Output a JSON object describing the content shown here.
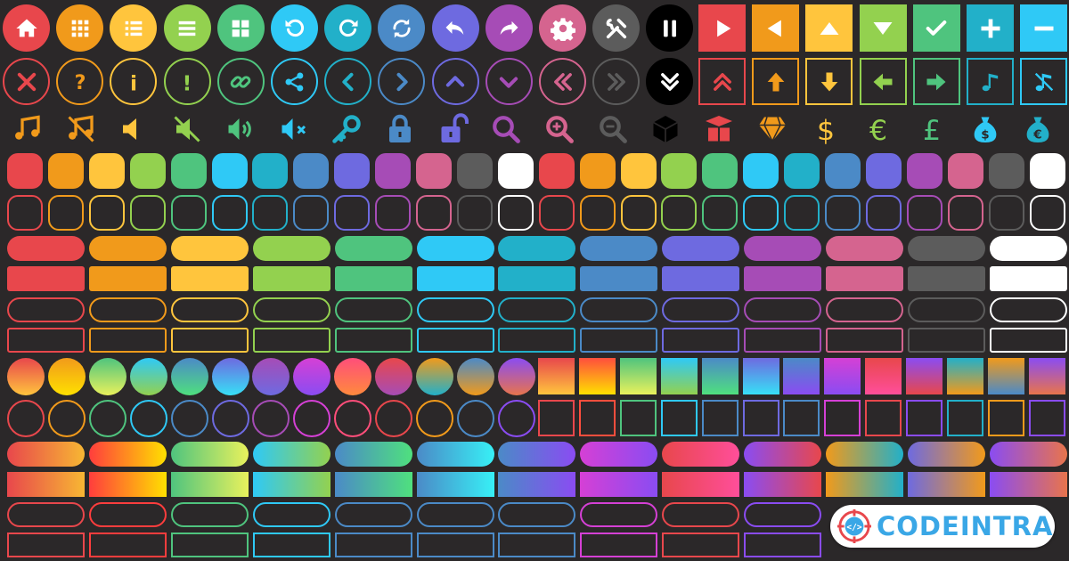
{
  "palette": {
    "red": "#e8474c",
    "orange": "#f19a1b",
    "yellow": "#ffc53d",
    "lime": "#93d14f",
    "green": "#4fc47e",
    "sky": "#2fc9f6",
    "teal": "#22b0c9",
    "blue": "#4b8ac7",
    "indigo": "#6e6ae0",
    "purple": "#a64cb6",
    "pink": "#d5648f",
    "gray": "#5c5c5c",
    "white": "#ffffff",
    "black": "#000000",
    "background": "#2b2829"
  },
  "icon_rows": {
    "row1_circle_icons": [
      "home-icon",
      "grid-icon",
      "list-icon",
      "menu-icon",
      "apps-icon",
      "rotate-left-icon",
      "rotate-right-icon",
      "sync-icon",
      "undo-icon",
      "redo-icon",
      "gear-icon",
      "tools-icon",
      "pause-icon"
    ],
    "row1_square_icons": [
      "play-icon",
      "back-icon",
      "triangle-up-icon",
      "triangle-down-icon",
      "check-icon",
      "plus-icon",
      "minus-icon"
    ],
    "row2_circle_icons": [
      "close-icon",
      "question-icon",
      "info-icon",
      "exclamation-icon",
      "link-icon",
      "share-icon",
      "chevron-left-icon",
      "chevron-right-icon",
      "chevron-up-icon",
      "chevron-down-icon",
      "double-chevron-left-icon",
      "double-chevron-right-icon",
      "double-chevron-down-icon"
    ],
    "row2_square_icons": [
      "double-chevron-up-icon",
      "arrow-up-icon",
      "arrow-down-icon",
      "arrow-left-icon",
      "arrow-right-icon",
      "music-note-icon",
      "music-note-off-icon"
    ],
    "row3_plain_icons": [
      "music-icon",
      "music-off-icon",
      "speaker-icon",
      "speaker-off-icon",
      "volume-up-icon",
      "volume-mute-icon",
      "key-icon",
      "lock-icon",
      "unlock-icon",
      "search-icon",
      "zoom-in-icon",
      "zoom-out-icon",
      "box-icon",
      "gift-box-icon",
      "diamond-icon",
      "dollar-icon",
      "euro-icon",
      "pound-icon",
      "money-bag-dollar-icon",
      "money-bag-euro-icon"
    ]
  },
  "logo": {
    "text": "CODEINTRA",
    "primary_color": "#3aa7e6",
    "accent_color": "#e8474c"
  }
}
